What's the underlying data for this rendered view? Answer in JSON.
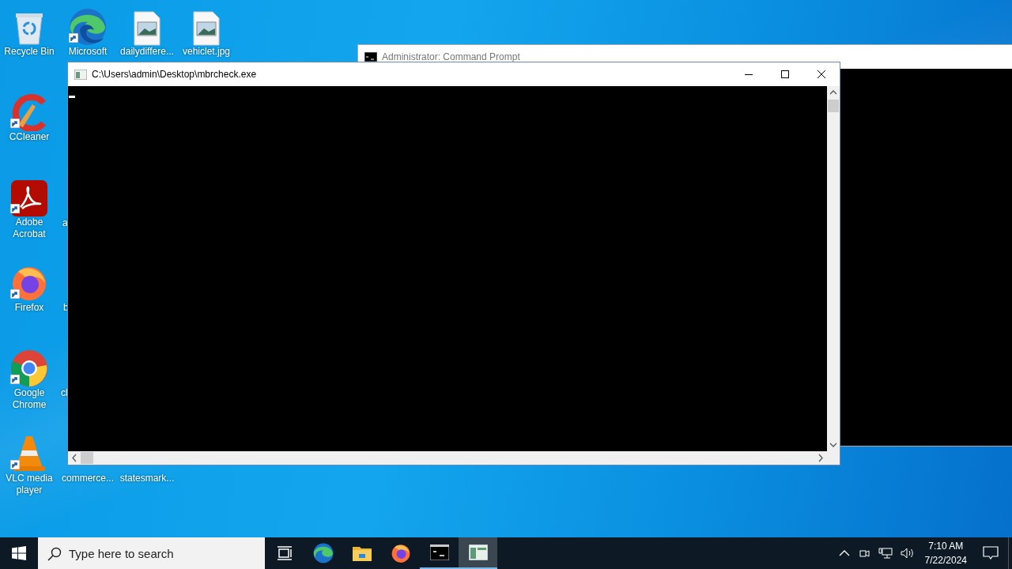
{
  "desktop": {
    "icons": [
      {
        "label": "Recycle Bin",
        "kind": "recycle-bin",
        "shortcut": false
      },
      {
        "label": "Microsoft",
        "kind": "edge",
        "shortcut": true
      },
      {
        "label": "dailydiffere...",
        "kind": "image",
        "shortcut": false
      },
      {
        "label": "vehiclet.jpg",
        "kind": "image",
        "shortcut": false
      },
      {
        "label": "CCleaner",
        "kind": "ccleaner",
        "shortcut": true
      },
      {
        "label": "Adobe Acrobat",
        "kind": "acrobat",
        "shortcut": true
      },
      {
        "label": "a",
        "kind": "hidden"
      },
      {
        "label": "Firefox",
        "kind": "firefox",
        "shortcut": true
      },
      {
        "label": "b",
        "kind": "hidden"
      },
      {
        "label": "Google Chrome",
        "kind": "chrome",
        "shortcut": true
      },
      {
        "label": "cl",
        "kind": "hidden"
      },
      {
        "label": "VLC media player",
        "kind": "vlc",
        "shortcut": true
      },
      {
        "label": "commerce...",
        "kind": "hidden"
      },
      {
        "label": "statesmark...",
        "kind": "hidden"
      }
    ]
  },
  "windows": [
    {
      "title": "Administrator: Command Prompt",
      "kind": "cmd",
      "focused": false
    },
    {
      "title": "C:\\Users\\admin\\Desktop\\mbrcheck.exe",
      "kind": "console",
      "focused": true,
      "cursor": true
    }
  ],
  "taskbar": {
    "search": {
      "placeholder": "Type here to search"
    },
    "apps": [
      {
        "kind": "task-view",
        "running": false,
        "selected": false
      },
      {
        "kind": "edge",
        "running": false,
        "selected": false
      },
      {
        "kind": "explorer",
        "running": false,
        "selected": false
      },
      {
        "kind": "firefox",
        "running": false,
        "selected": false
      },
      {
        "kind": "cmd",
        "running": true,
        "selected": false
      },
      {
        "kind": "console",
        "running": true,
        "selected": true
      }
    ],
    "clock": {
      "time": "7:10 AM",
      "date": "7/22/2024"
    }
  }
}
